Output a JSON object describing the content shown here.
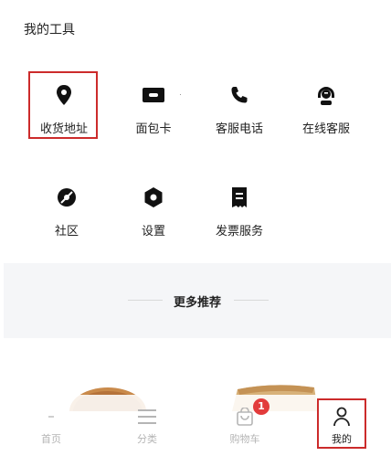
{
  "section": {
    "title": "我的工具"
  },
  "tools": [
    {
      "label": "收货地址",
      "icon": "location-pin-icon"
    },
    {
      "label": "面包卡",
      "icon": "card-icon"
    },
    {
      "label": "客服电话",
      "icon": "phone-icon"
    },
    {
      "label": "在线客服",
      "icon": "headset-icon"
    },
    {
      "label": "社区",
      "icon": "community-icon"
    },
    {
      "label": "设置",
      "icon": "settings-icon"
    },
    {
      "label": "发票服务",
      "icon": "invoice-icon"
    }
  ],
  "more": {
    "title": "更多推荐"
  },
  "tabbar": {
    "items": [
      {
        "label": "首页",
        "icon": "home-icon"
      },
      {
        "label": "分类",
        "icon": "menu-icon"
      },
      {
        "label": "购物车",
        "icon": "cart-icon",
        "badge": "1"
      },
      {
        "label": "我的",
        "icon": "user-icon",
        "active": true
      }
    ]
  },
  "colors": {
    "accent": "#e23b3b",
    "highlight": "#cc2b2b",
    "band": "#f5f6f8"
  }
}
